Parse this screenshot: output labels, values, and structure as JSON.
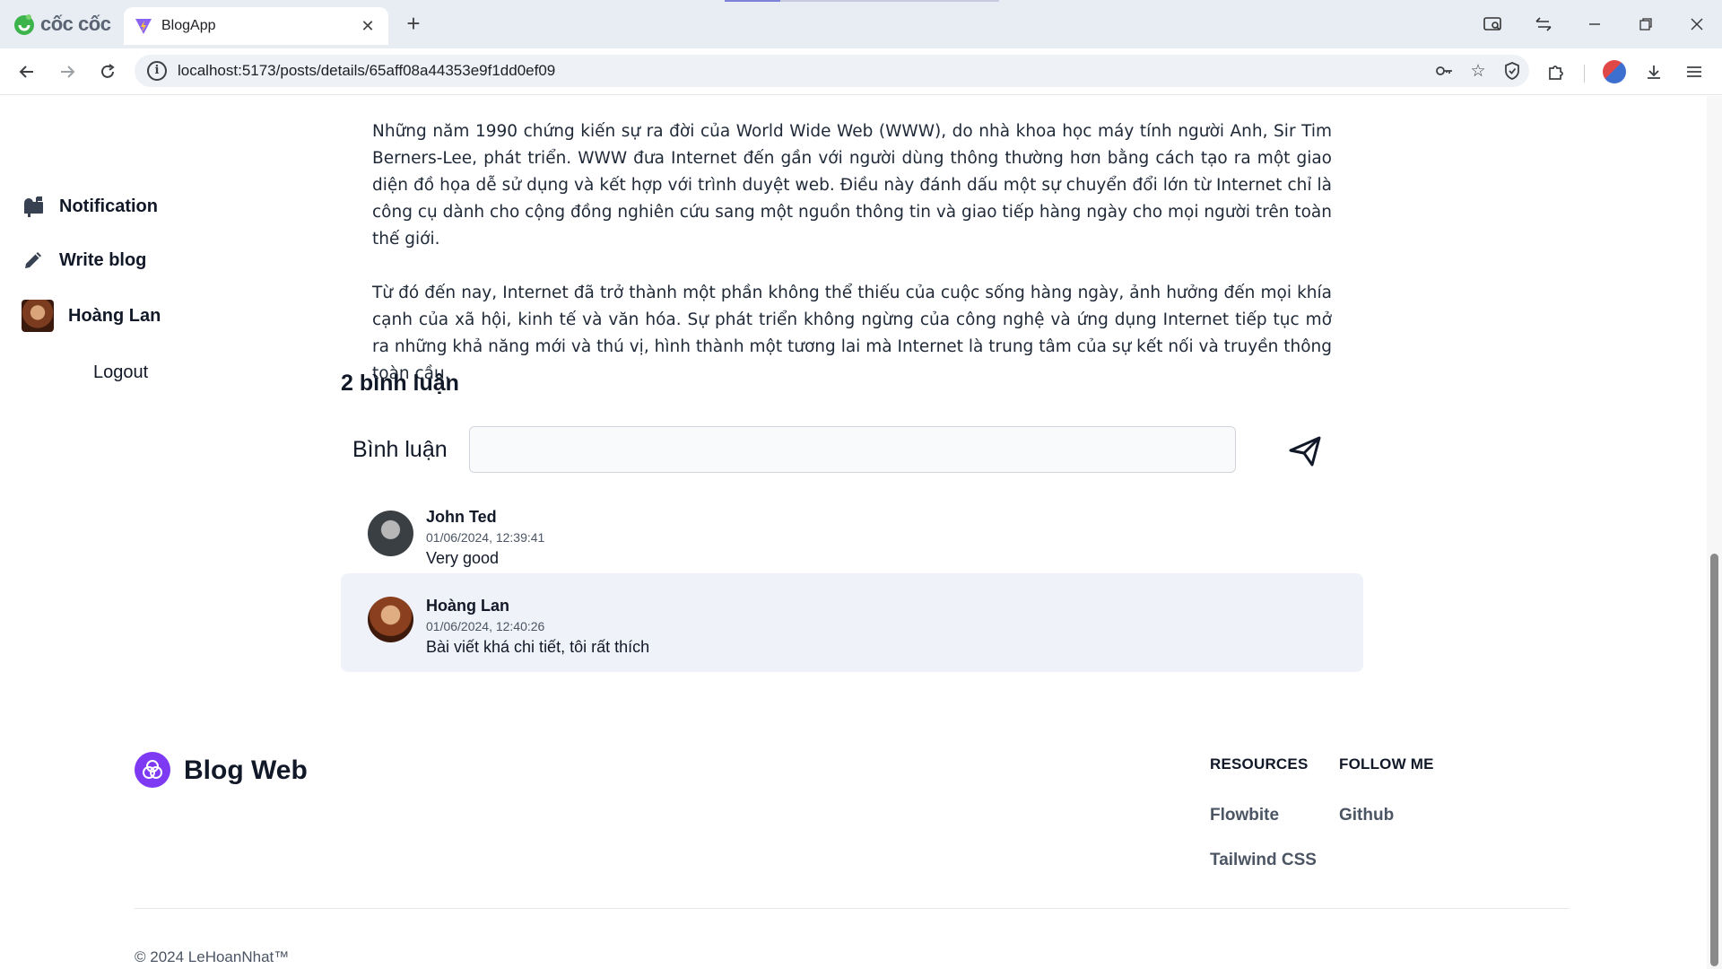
{
  "browser": {
    "brand": "cốc cốc",
    "tab_title": "BlogApp",
    "url": "localhost:5173/posts/details/65aff08a44353e9f1dd0ef09"
  },
  "sidebar": {
    "notification": "Notification",
    "write_blog": "Write blog",
    "user_name": "Hoàng Lan",
    "logout": "Logout"
  },
  "article": {
    "paragraphs": [
      "Những năm 1990 chứng kiến sự ra đời của World Wide Web (WWW), do nhà khoa học máy tính người Anh, Sir Tim Berners-Lee, phát triển. WWW đưa Internet đến gần với người dùng thông thường hơn bằng cách tạo ra một giao diện đồ họa dễ sử dụng và kết hợp với trình duyệt web. Điều này đánh dấu một sự chuyển đổi lớn từ Internet chỉ là công cụ dành cho cộng đồng nghiên cứu sang một nguồn thông tin và giao tiếp hàng ngày cho mọi người trên toàn thế giới.",
      "Từ đó đến nay, Internet đã trở thành một phần không thể thiếu của cuộc sống hàng ngày, ảnh hưởng đến mọi khía cạnh của xã hội, kinh tế và văn hóa. Sự phát triển không ngừng của công nghệ và ứng dụng Internet tiếp tục mở ra những khả năng mới và thú vị, hình thành một tương lai mà Internet là trung tâm của sự kết nối và truyền thông toàn cầu."
    ]
  },
  "comments": {
    "title": "2 bình luận",
    "form_label": "Bình luận",
    "input_value": "",
    "items": [
      {
        "name": "John Ted",
        "date": "01/06/2024, 12:39:41",
        "text": "Very good"
      },
      {
        "name": "Hoàng Lan",
        "date": "01/06/2024, 12:40:26",
        "text": "Bài viết khá chi tiết, tôi rất thích"
      }
    ]
  },
  "footer": {
    "brand": "Blog Web",
    "resources_title": "RESOURCES",
    "follow_title": "FOLLOW ME",
    "resources": [
      "Flowbite",
      "Tailwind CSS"
    ],
    "follow": [
      "Github"
    ],
    "copyright": "© 2024 LeHoanNhat™"
  },
  "colors": {
    "accent": "#7e3af2",
    "comment_highlight": "#eff2f8"
  }
}
